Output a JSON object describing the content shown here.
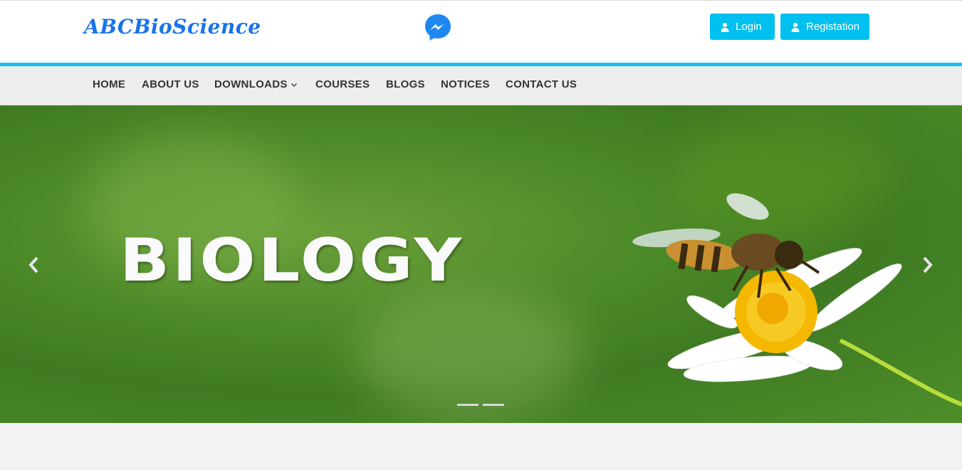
{
  "header": {
    "logo_text": "ABCBioScience",
    "messenger_icon": "messenger-icon",
    "login_label": "Login",
    "register_label": "Registation",
    "accent_color": "#1ec0f2",
    "button_color": "#00c0f0"
  },
  "nav": {
    "items": [
      {
        "label": "HOME"
      },
      {
        "label": "ABOUT US"
      },
      {
        "label": "DOWNLOADS",
        "has_dropdown": true
      },
      {
        "label": "COURSES"
      },
      {
        "label": "BLOGS"
      },
      {
        "label": "NOTICES"
      },
      {
        "label": "CONTACT US"
      }
    ]
  },
  "carousel": {
    "slide_title": "BIOLOGY",
    "indicator_count": 2,
    "active_indicator": 1
  }
}
